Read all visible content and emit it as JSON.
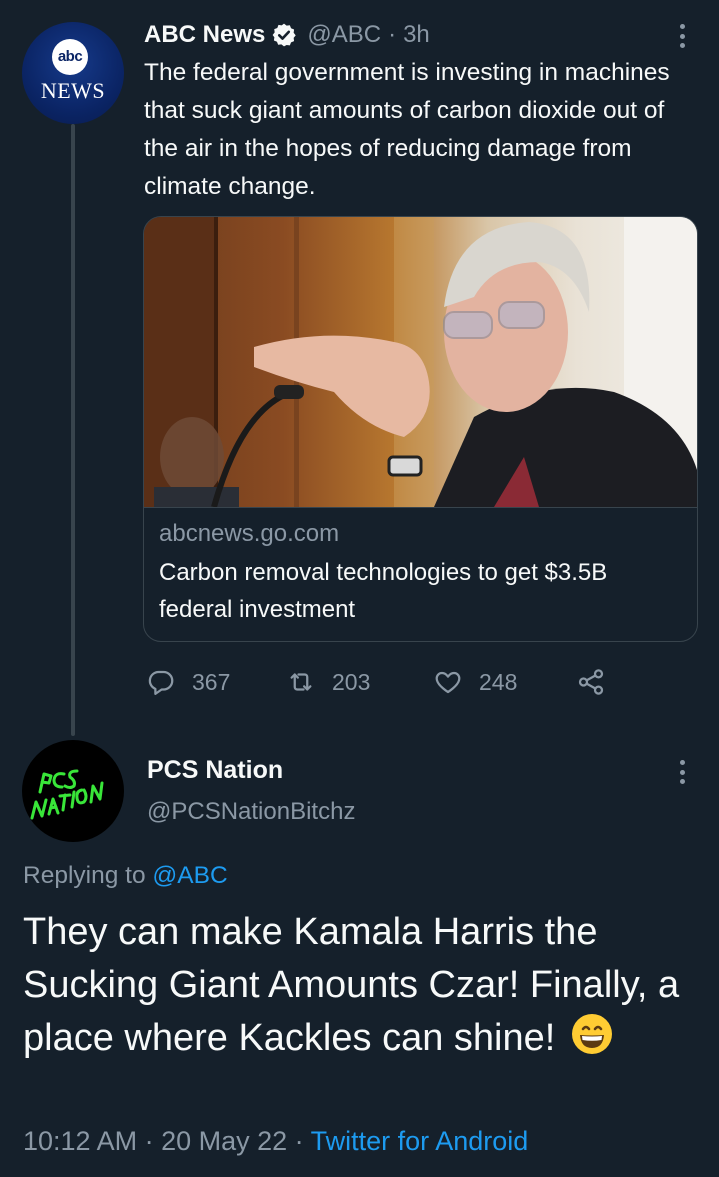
{
  "tweet": {
    "author_name": "ABC News",
    "handle": "@ABC",
    "separator": "·",
    "time": "3h",
    "text": "The federal government is investing in machines that suck giant amounts of carbon dioxide out of the air in the hopes of reducing damage from climate change.",
    "avatar_logo": "abc",
    "avatar_wordmark": "NEWS",
    "verified_icon": "verified-badge-icon",
    "card": {
      "domain": "abcnews.go.com",
      "title": "Carbon removal technologies to get $3.5B federal investment"
    },
    "actions": {
      "replies": "367",
      "retweets": "203",
      "likes": "248"
    }
  },
  "reply": {
    "author_name": "PCS Nation",
    "handle": "@PCSNationBitchz",
    "replying_prefix": "Replying to",
    "replying_to": "@ABC",
    "text": "They can make Kamala Harris the Sucking Giant Amounts Czar! Finally, a place where Kackles can shine!",
    "emoji": "grinning-face",
    "timestamp": "10:12 AM · 20 May 22 ·",
    "source": "Twitter for Android"
  },
  "colors": {
    "background": "#15202b",
    "primary_text": "#f7f9f9",
    "secondary_text": "#8b98a5",
    "link": "#1d9bf0",
    "border": "#38444d",
    "pcs_logo": "#39e639"
  }
}
